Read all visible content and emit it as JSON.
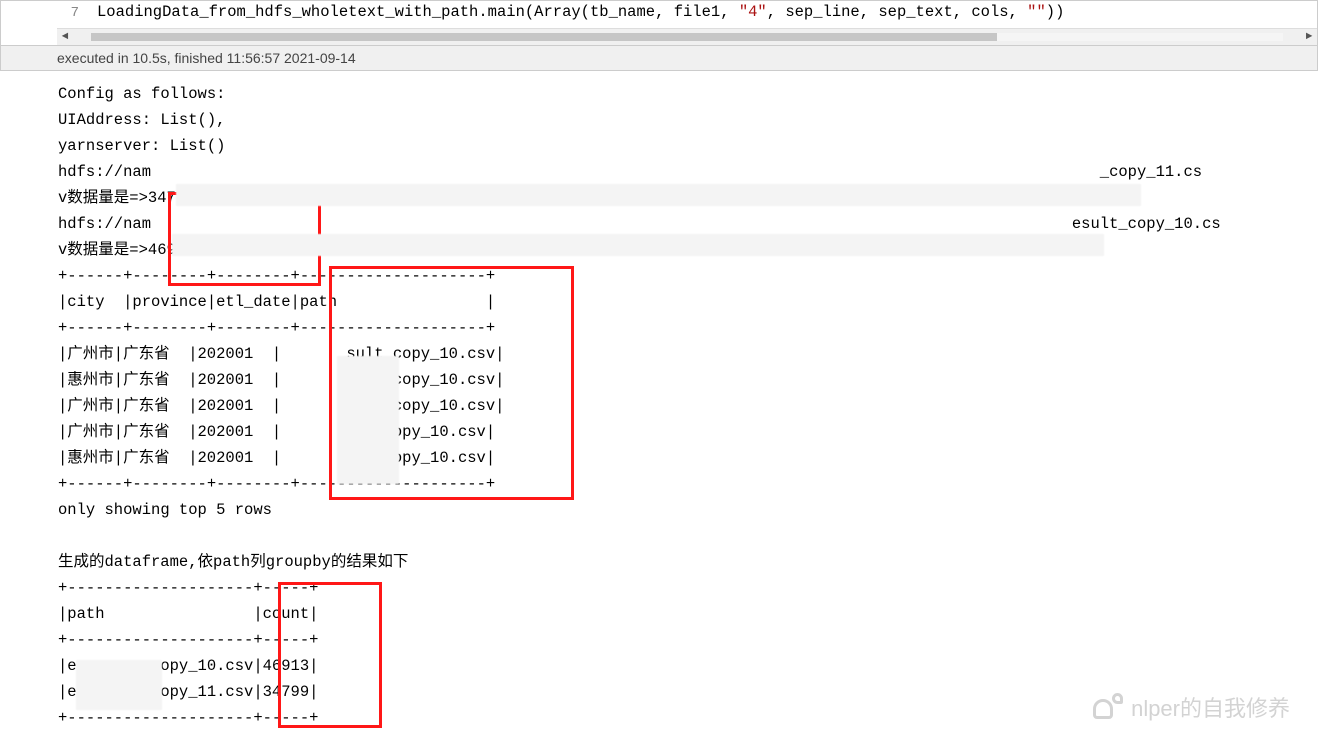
{
  "code": {
    "lineno_prev": "",
    "lineno": "7",
    "text_plain": "LoadingData_from_hdfs_wholetext_with_path.main(Array(tb_name, file1, ",
    "quoted4": "\"4\"",
    "text_mid": ", sep_line, sep_text, cols, ",
    "quoted_empty": "\"\"",
    "text_end": "))"
  },
  "exec_status": "executed in 10.5s, finished 11:56:57 2021-09-14",
  "output": {
    "lines": [
      "Config as follows:",
      "UIAddress: List(),",
      "yarnserver: List()",
      "hdfs://nam                                                                                                      _copy_11.cs",
      "v数据量是=>34799",
      "hdfs://nam                                                                                                   esult_copy_10.cs",
      "v数据量是=>46913",
      "+------+--------+--------+--------------------+",
      "|city  |province|etl_date|path                |",
      "+------+--------+--------+--------------------+",
      "|广州市|广东省  |202001  |       sult_copy_10.csv|",
      "|惠州市|广东省  |202001  |        ult_copy_10.csv|",
      "|广州市|广东省  |202001  |        ilt_copy_10.csv|",
      "|广州市|广东省  |202001  |        lt_copy_10.csv|",
      "|惠州市|广东省  |202001  |        .t_copy_10.csv|",
      "+------+--------+--------+--------------------+",
      "only showing top 5 rows",
      "",
      "生成的dataframe,依path列groupby的结果如下",
      "+--------------------+-----+",
      "|path                |count|",
      "+--------------------+-----+",
      "|e       _copy_10.csv|46913|",
      "|e       _copy_11.csv|34799|",
      "+--------------------+-----+"
    ]
  },
  "table1": {
    "headers": [
      "city",
      "province",
      "etl_date",
      "path"
    ],
    "rows": [
      [
        "广州市",
        "广东省",
        "202001",
        "sult_copy_10.csv"
      ],
      [
        "惠州市",
        "广东省",
        "202001",
        "ult_copy_10.csv"
      ],
      [
        "广州市",
        "广东省",
        "202001",
        "ilt_copy_10.csv"
      ],
      [
        "广州市",
        "广东省",
        "202001",
        "lt_copy_10.csv"
      ],
      [
        "惠州市",
        "广东省",
        "202001",
        ".t_copy_10.csv"
      ]
    ],
    "footer": "only showing top 5 rows"
  },
  "table2": {
    "caption": "生成的dataframe,依path列groupby的结果如下",
    "headers": [
      "path",
      "count"
    ],
    "rows": [
      [
        "_copy_10.csv",
        "46913"
      ],
      [
        "_copy_11.csv",
        "34799"
      ]
    ]
  },
  "counts": {
    "a": "34799",
    "b": "46913"
  },
  "watermark": {
    "text": "nlper的自我修养"
  }
}
